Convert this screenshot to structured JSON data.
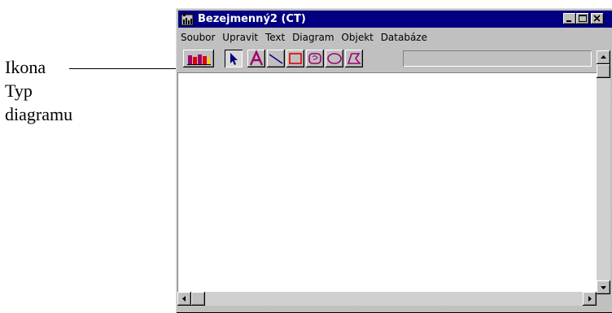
{
  "annotation": {
    "line1": "Ikona",
    "line2": "Typ",
    "line3": "diagramu"
  },
  "window": {
    "title": "Bezejmenný2 (CT)",
    "menu": [
      "Soubor",
      "Upravit",
      "Text",
      "Diagram",
      "Objekt",
      "Databáze"
    ]
  },
  "toolbar": {
    "tools": [
      "chart-type-icon",
      "pointer-arrow-icon",
      "text-tool-icon",
      "line-tool-icon",
      "rectangle-tool-icon",
      "rounded-rectangle-tool-icon",
      "ellipse-tool-icon",
      "polygon-tool-icon"
    ],
    "status_text": ""
  },
  "colors": {
    "titlebar": "#000080",
    "face": "#c0c0c0",
    "tool_accent": "#a0006e",
    "tool_red": "#e00000"
  }
}
